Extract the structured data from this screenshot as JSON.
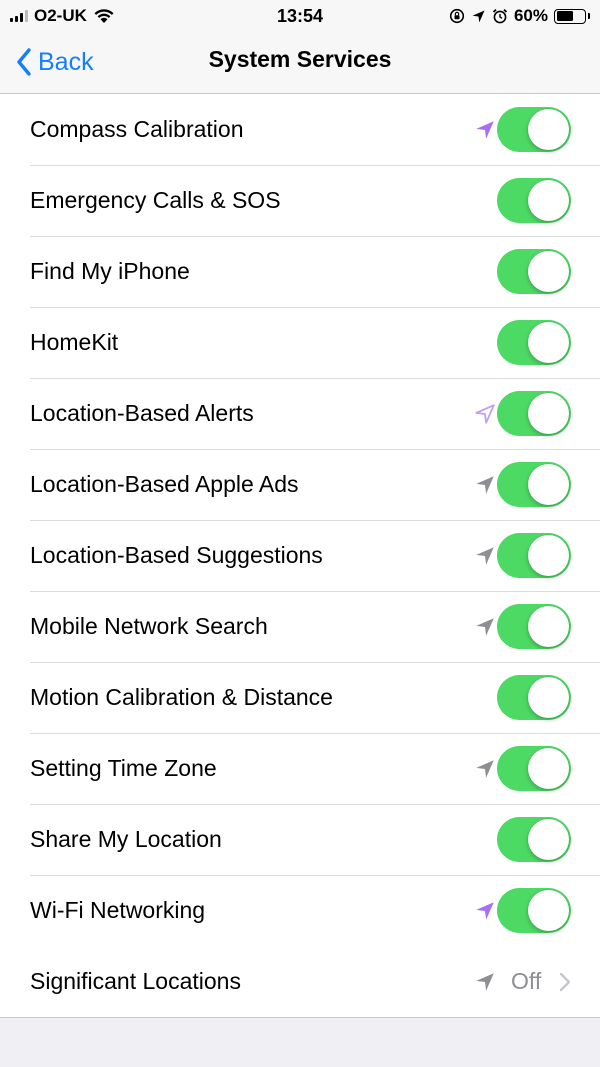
{
  "status_bar": {
    "carrier": "O2-UK",
    "time": "13:54",
    "battery_percent": "60%",
    "battery_level": 0.6,
    "icons": [
      "signal-icon",
      "wifi-icon",
      "orientation-lock-icon",
      "location-icon",
      "alarm-icon",
      "battery-icon"
    ]
  },
  "nav": {
    "back_label": "Back",
    "title": "System Services"
  },
  "colors": {
    "accent": "#157efb",
    "toggle_on": "#4cd964",
    "arrow_recent": "#a86ff0",
    "arrow_recent_light": "#c59bf5",
    "arrow_past": "#8e8e93",
    "secondary_text": "#8e8e93"
  },
  "services": [
    {
      "label": "Compass Calibration",
      "enabled": true,
      "location_indicator": "purple-filled"
    },
    {
      "label": "Emergency Calls & SOS",
      "enabled": true,
      "location_indicator": "none"
    },
    {
      "label": "Find My iPhone",
      "enabled": true,
      "location_indicator": "none"
    },
    {
      "label": "HomeKit",
      "enabled": true,
      "location_indicator": "none"
    },
    {
      "label": "Location-Based Alerts",
      "enabled": true,
      "location_indicator": "purple-outline"
    },
    {
      "label": "Location-Based Apple Ads",
      "enabled": true,
      "location_indicator": "gray-filled"
    },
    {
      "label": "Location-Based Suggestions",
      "enabled": true,
      "location_indicator": "gray-filled"
    },
    {
      "label": "Mobile Network Search",
      "enabled": true,
      "location_indicator": "gray-filled"
    },
    {
      "label": "Motion Calibration & Distance",
      "enabled": true,
      "location_indicator": "none"
    },
    {
      "label": "Setting Time Zone",
      "enabled": true,
      "location_indicator": "gray-filled"
    },
    {
      "label": "Share My Location",
      "enabled": true,
      "location_indicator": "none"
    },
    {
      "label": "Wi-Fi Networking",
      "enabled": true,
      "location_indicator": "purple-filled"
    }
  ],
  "significant_locations": {
    "label": "Significant Locations",
    "value": "Off",
    "location_indicator": "gray-filled"
  }
}
